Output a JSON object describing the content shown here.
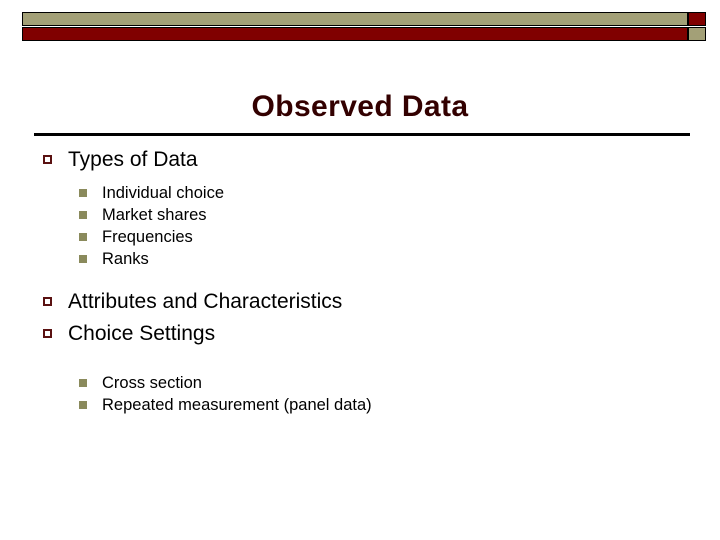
{
  "slide": {
    "title": "Observed Data",
    "theme": {
      "banner_olive": "#a3a077",
      "banner_maroon": "#800000",
      "title_color": "#330000",
      "level1_bullet_color": "#5a1111",
      "level2_bullet_color": "#8a8a5c",
      "background": "#ffffff",
      "rule_color": "#000000"
    },
    "content": [
      {
        "level": 1,
        "text": "Types of Data",
        "children": [
          {
            "level": 2,
            "text": "Individual choice"
          },
          {
            "level": 2,
            "text": "Market shares"
          },
          {
            "level": 2,
            "text": "Frequencies"
          },
          {
            "level": 2,
            "text": "Ranks"
          }
        ]
      },
      {
        "level": 1,
        "text": "Attributes and Characteristics",
        "children": []
      },
      {
        "level": 1,
        "text": "Choice Settings",
        "children": [
          {
            "level": 2,
            "text": "Cross section"
          },
          {
            "level": 2,
            "text": "Repeated measurement (panel data)"
          }
        ]
      }
    ],
    "icons": {
      "level1_bullet": "hollow-square-bullet",
      "level2_bullet": "filled-square-bullet"
    }
  }
}
